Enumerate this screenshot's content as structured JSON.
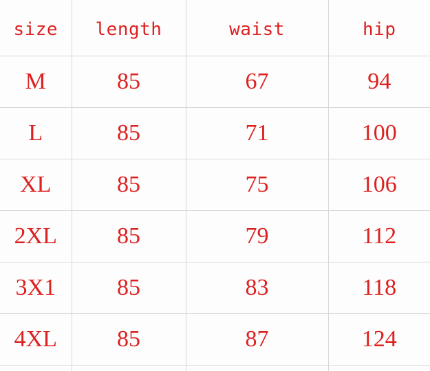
{
  "table": {
    "columns": [
      "size",
      "length",
      "waist",
      "hip"
    ],
    "rows": [
      {
        "size": "M",
        "length": "85",
        "waist": "67",
        "hip": "94"
      },
      {
        "size": "L",
        "length": "85",
        "waist": "71",
        "hip": "100"
      },
      {
        "size": "XL",
        "length": "85",
        "waist": "75",
        "hip": "106"
      },
      {
        "size": "2XL",
        "length": "85",
        "waist": "79",
        "hip": "112"
      },
      {
        "size": "3X1",
        "length": "85",
        "waist": "83",
        "hip": "118"
      },
      {
        "size": "4XL",
        "length": "85",
        "waist": "87",
        "hip": "124"
      }
    ]
  },
  "colors": {
    "text": "#dd2020",
    "grid": "#d8d8d8",
    "background": "#fdfdfd"
  }
}
